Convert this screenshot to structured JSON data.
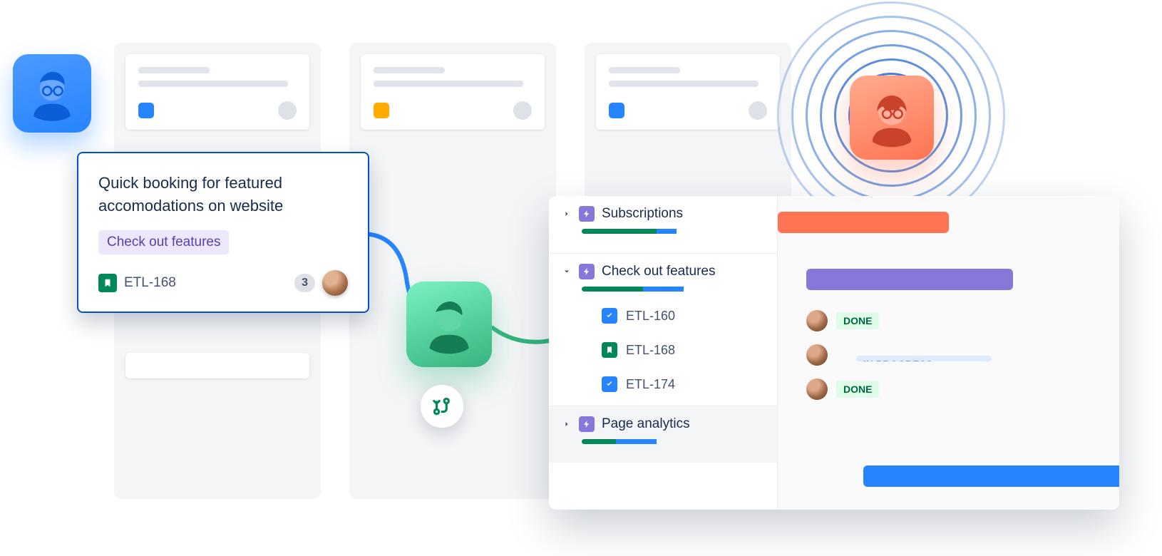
{
  "columns": [
    {
      "card_color": "#2684FF"
    },
    {
      "card_color": "#FFAB00"
    },
    {
      "card_color": "#2684FF"
    }
  ],
  "low_card_color": "#FF7452",
  "featured": {
    "title": "Quick booking for featured accomodations on website",
    "tag": "Check out features",
    "issue_key": "ETL-168",
    "count": "3"
  },
  "roadmap": {
    "epics": [
      {
        "name": "Subscriptions",
        "expanded": false,
        "progress_green": 0.55,
        "progress_blue": 0.15,
        "bar": {
          "color": "orange",
          "start": 0,
          "len": 240
        }
      },
      {
        "name": "Check out features",
        "expanded": true,
        "progress_green": 0.45,
        "progress_blue": 0.3,
        "bar": {
          "color": "purple",
          "start": 40,
          "len": 290
        },
        "children": [
          {
            "type": "task",
            "key": "ETL-160",
            "status": "DONE"
          },
          {
            "type": "story",
            "key": "ETL-168",
            "status": "IN PROGRESS"
          },
          {
            "type": "task",
            "key": "ETL-174",
            "status": "DONE"
          }
        ]
      },
      {
        "name": "Page analytics",
        "expanded": false,
        "progress_green": 0.25,
        "progress_blue": 0.3,
        "bar": {
          "color": "blue",
          "start": 120,
          "len": 360
        }
      }
    ]
  }
}
